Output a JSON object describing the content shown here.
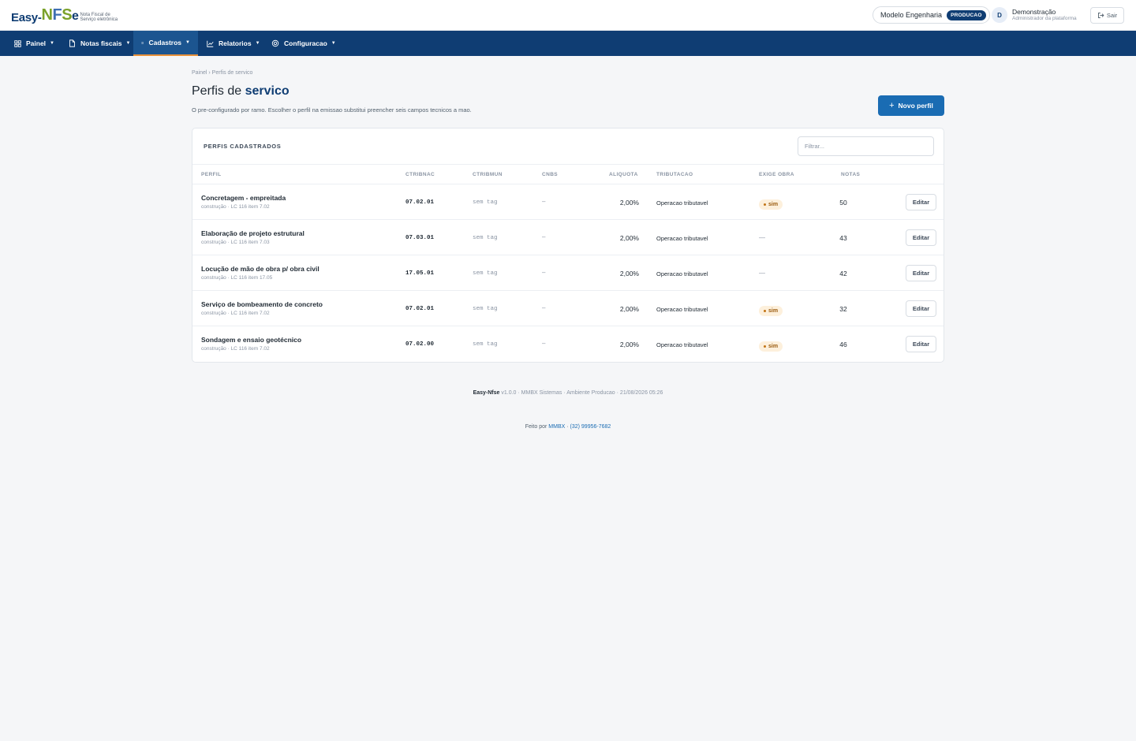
{
  "brand": {
    "logo_easy": "Easy-",
    "logo_n": "N",
    "logo_f": "F",
    "logo_s": "S",
    "logo_e": "e",
    "tagline": "Nota Fiscal de Serviço eletrônica"
  },
  "header": {
    "company": "Modelo Engenharia",
    "environment": "PRODUCAO",
    "user_initial": "D",
    "user_name": "Demonstração",
    "user_role": "Administrador da plataforma",
    "logout_label": "Sair"
  },
  "nav": {
    "items": [
      {
        "label": "Painel",
        "icon": "grid-icon"
      },
      {
        "label": "Notas fiscais",
        "icon": "document-icon"
      },
      {
        "label": "Cadastros",
        "icon": "list-icon",
        "active": true
      },
      {
        "label": "Relatorios",
        "icon": "chart-icon"
      },
      {
        "label": "Configuracao",
        "icon": "gear-icon"
      }
    ]
  },
  "page": {
    "breadcrumb": "Painel › Perfis de servico",
    "title_prefix": "Perfis de ",
    "title_bold": "servico",
    "subtitle": "O pre-configurado por ramo. Escolher o perfil na emissao substitui preencher seis campos tecnicos a mao.",
    "new_button": "Novo perfil"
  },
  "table": {
    "card_title": "PERFIS CADASTRADOS",
    "filter_placeholder": "Filtrar...",
    "columns": {
      "perfil": "PERFIL",
      "ctribnac": "CTRIBNAC",
      "ctribmun": "CTRIBMUN",
      "cnbs": "CNBS",
      "aliquota": "ALIQUOTA",
      "tributacao": "TRIBUTACAO",
      "exige_obra": "EXIGE OBRA",
      "notas": "NOTAS"
    },
    "edit_label": "Editar",
    "rows": [
      {
        "name": "Concretagem - empreitada",
        "sub": "construção · LC 116 item 7.02",
        "ctribnac": "07.02.01",
        "ctribmun": "sem tag",
        "cnbs": "–",
        "aliquota": "2,00%",
        "tributacao": "Operacao tributavel",
        "exige_obra": "sim",
        "obra": true,
        "notas": "50"
      },
      {
        "name": "Elaboração de projeto estrutural",
        "sub": "construção · LC 116 item 7.03",
        "ctribnac": "07.03.01",
        "ctribmun": "sem tag",
        "cnbs": "–",
        "aliquota": "2,00%",
        "tributacao": "Operacao tributavel",
        "exige_obra": "—",
        "obra": false,
        "notas": "43"
      },
      {
        "name": "Locução de mão de obra p/ obra civil",
        "sub": "construção · LC 116 item 17.05",
        "ctribnac": "17.05.01",
        "ctribmun": "sem tag",
        "cnbs": "–",
        "aliquota": "2,00%",
        "tributacao": "Operacao tributavel",
        "exige_obra": "—",
        "obra": false,
        "notas": "42"
      },
      {
        "name": "Serviço de bombeamento de concreto",
        "sub": "construção · LC 116 item 7.02",
        "ctribnac": "07.02.01",
        "ctribmun": "sem tag",
        "cnbs": "–",
        "aliquota": "2,00%",
        "tributacao": "Operacao tributavel",
        "exige_obra": "sim",
        "obra": true,
        "notas": "32"
      },
      {
        "name": "Sondagem e ensaio geotécnico",
        "sub": "construção · LC 116 item 7.02",
        "ctribnac": "07.02.00",
        "ctribmun": "sem tag",
        "cnbs": "–",
        "aliquota": "2,00%",
        "tributacao": "Operacao tributavel",
        "exige_obra": "sim",
        "obra": true,
        "notas": "46"
      }
    ]
  },
  "footer": {
    "brand": "Easy-Nfse",
    "info": " v1.0.0 · MMBX Sistemas · Ambiente Producao · 21/08/2026 05:26",
    "made_by": "Feito por ",
    "company_link": "MMBX",
    "sep": " · ",
    "phone": "(32) 99956-7682"
  },
  "colors": {
    "primary": "#0f3d73",
    "accent": "#1a6cb3",
    "active_underline": "#e8913a",
    "badge_bg": "#fdf0dc"
  }
}
